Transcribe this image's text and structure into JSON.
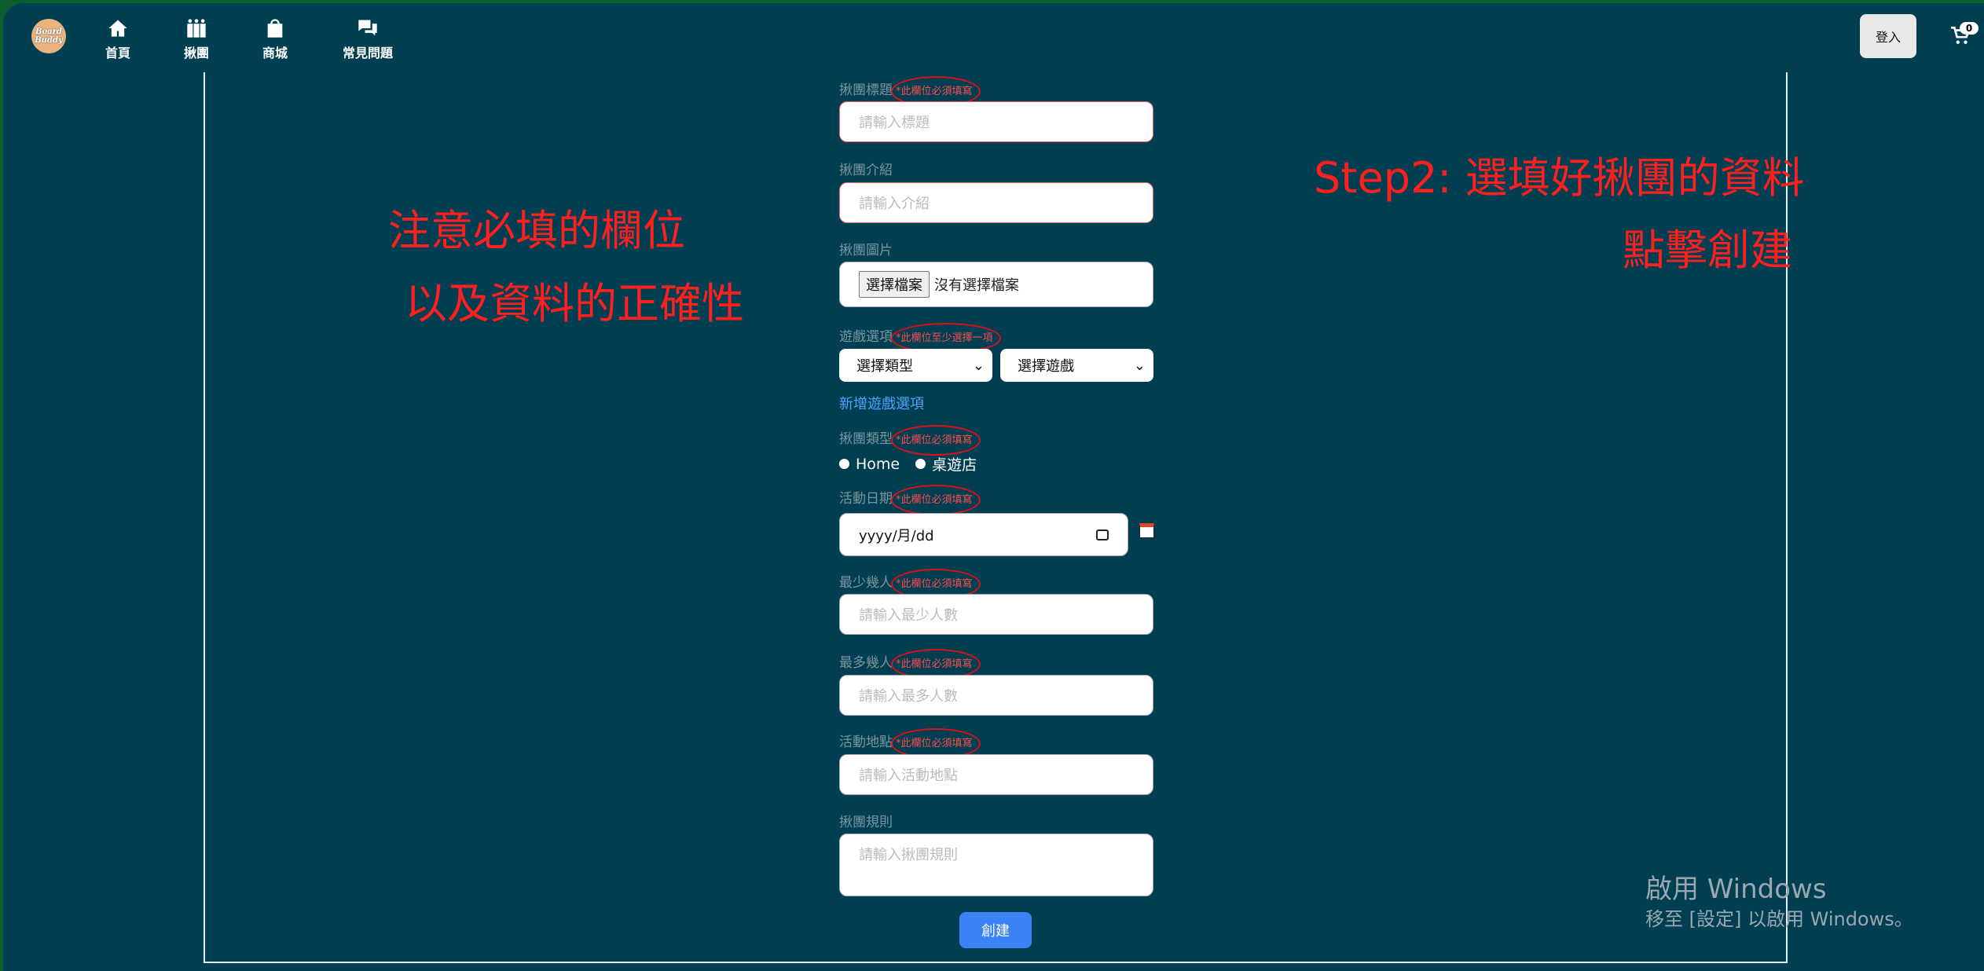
{
  "nav": {
    "logo": "Board Buddy",
    "items": [
      {
        "label": "首頁",
        "icon": "home-icon"
      },
      {
        "label": "揪團",
        "icon": "group-icon"
      },
      {
        "label": "商城",
        "icon": "shopping-bag-icon"
      },
      {
        "label": "常見問題",
        "icon": "chat-icon"
      }
    ],
    "login": "登入",
    "cart_count": "0"
  },
  "form": {
    "title": {
      "label": "揪團標題",
      "req": "*此欄位必須填寫",
      "placeholder": "請輸入標題"
    },
    "intro": {
      "label": "揪團介紹",
      "placeholder": "請輸入介紹"
    },
    "image": {
      "label": "揪團圖片",
      "button": "選擇檔案",
      "status": "沒有選擇檔案"
    },
    "games": {
      "label": "遊戲選項",
      "req": "*此欄位至少選擇一項",
      "type_select": "選擇類型",
      "game_select": "選擇遊戲",
      "add_link": "新增遊戲選項"
    },
    "kind": {
      "label": "揪團類型",
      "req": "*此欄位必須填寫",
      "options": [
        "Home",
        "桌遊店"
      ]
    },
    "date": {
      "label": "活動日期",
      "req": "*此欄位必須填寫",
      "placeholder": "yyyy/月/dd"
    },
    "min": {
      "label": "最少幾人",
      "req": "*此欄位必須填寫",
      "placeholder": "請輸入最少人數"
    },
    "max": {
      "label": "最多幾人",
      "req": "*此欄位必須填寫",
      "placeholder": "請輸入最多人數"
    },
    "place": {
      "label": "活動地點",
      "req": "*此欄位必須填寫",
      "placeholder": "請輸入活動地點"
    },
    "rules": {
      "label": "揪團規則",
      "placeholder": "請輸入揪團規則"
    },
    "submit": "創建"
  },
  "annotations": {
    "left1": "注意必填的欄位",
    "left2": "以及資料的正確性",
    "right1": "Step2: 選填好揪團的資料",
    "right2": "點擊創建"
  },
  "watermark": {
    "title": "啟用 Windows",
    "sub": "移至 [設定] 以啟用 Windows。"
  }
}
